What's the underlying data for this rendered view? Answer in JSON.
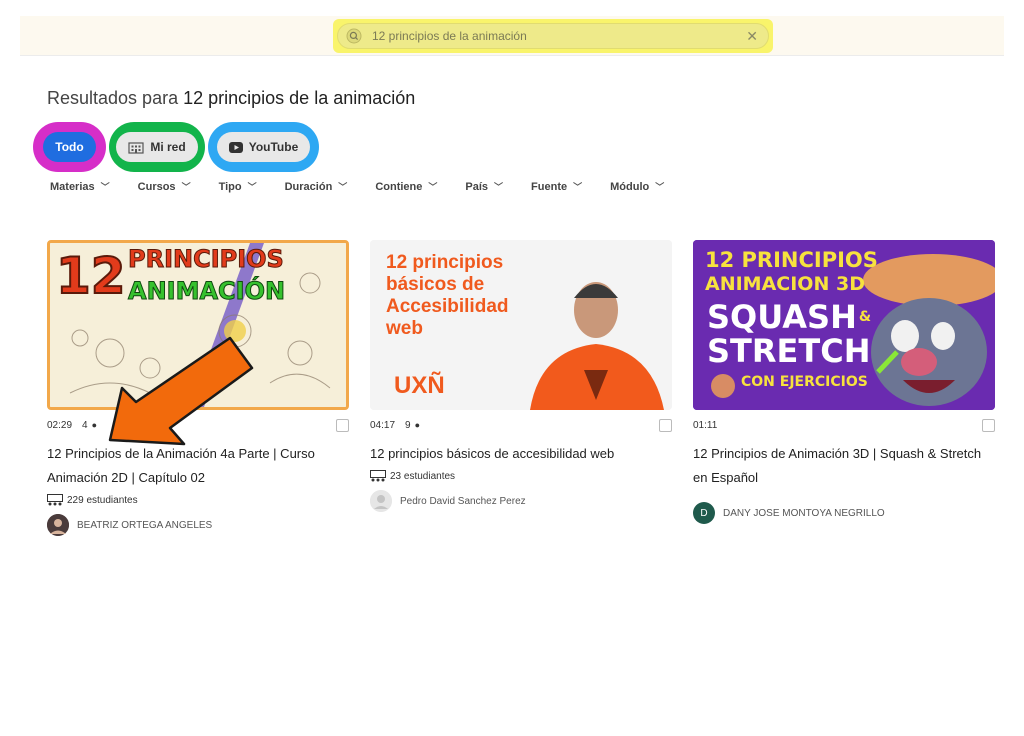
{
  "search": {
    "value": "12 principios de la animación"
  },
  "results": {
    "prefix": "Resultados para",
    "query": "12 principios de la animación"
  },
  "chips": [
    {
      "label": "Todo"
    },
    {
      "label": "Mi red"
    },
    {
      "label": "YouTube"
    }
  ],
  "filters": [
    "Materias",
    "Cursos",
    "Tipo",
    "Duración",
    "Contiene",
    "País",
    "Fuente",
    "Módulo"
  ],
  "cards": [
    {
      "thumb": {
        "lines": [
          "12",
          "PRINCIPIOS",
          "ANIMACIÓN"
        ]
      },
      "duration": "02:29",
      "views": "4",
      "title": "12 Principios de la Animación 4a Parte | Curso Animación 2D | Capítulo 02",
      "students": "229 estudiantes",
      "author": "BEATRIZ ORTEGA ANGELES"
    },
    {
      "thumb": {
        "lines": [
          "12 principios",
          "básicos de",
          "Accesibilidad",
          "web",
          "UXÑ"
        ]
      },
      "duration": "04:17",
      "views": "9",
      "title": "12 principios básicos de accesibilidad web",
      "students": "23 estudiantes",
      "author": "Pedro David Sanchez Perez"
    },
    {
      "thumb": {
        "lines": [
          "12 PRINCIPIOS",
          "ANIMACION 3D",
          "SQUASH",
          "&",
          "STRETCH",
          "CON EJERCICIOS"
        ]
      },
      "duration": "01:11",
      "title": "12 Principios de Animación 3D | Squash & Stretch  en Español",
      "author": "DANY JOSE MONTOYA NEGRILLO",
      "author_initial": "D"
    }
  ],
  "colors": {
    "highlight_yellow": "#f9f46b",
    "ring_pink": "#d62ec8",
    "ring_green": "#12b44b",
    "ring_blue": "#2ea8f3",
    "chip_active": "#1f6de0",
    "arrow_orange": "#f26a0c"
  }
}
